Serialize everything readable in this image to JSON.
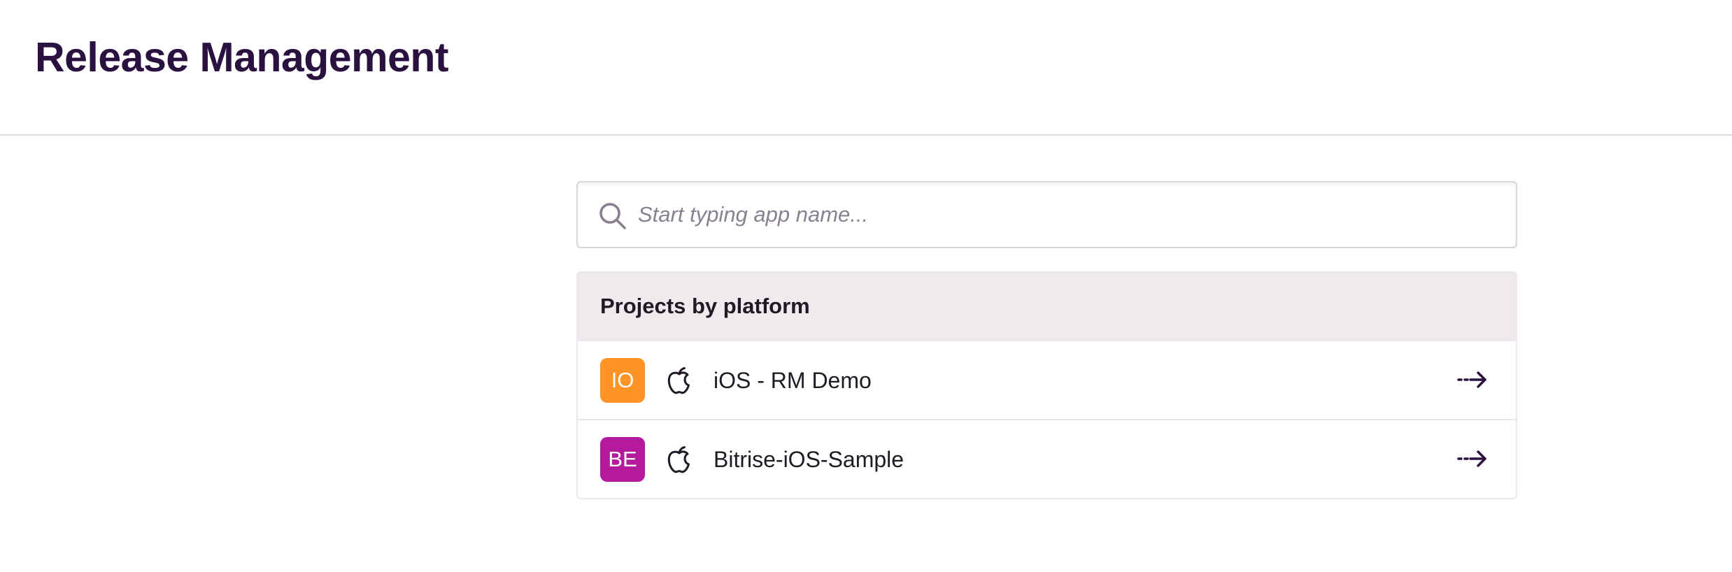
{
  "header": {
    "title": "Release Management"
  },
  "search": {
    "placeholder": "Start typing app name...",
    "value": "",
    "icon": "search-icon"
  },
  "projects_panel": {
    "title": "Projects by platform",
    "items": [
      {
        "initials": "IO",
        "name": "iOS - RM Demo",
        "platform_icon": "apple-icon",
        "avatar_color": "#ff9426",
        "action_icon": "arrow-right-icon"
      },
      {
        "initials": "BE",
        "name": "Bitrise-iOS-Sample",
        "platform_icon": "apple-icon",
        "avatar_color": "#b51a9d",
        "action_icon": "arrow-right-icon"
      }
    ]
  },
  "colors": {
    "title": "#2b1140",
    "divider": "#dedade",
    "panel_header_bg": "#efeaee"
  }
}
